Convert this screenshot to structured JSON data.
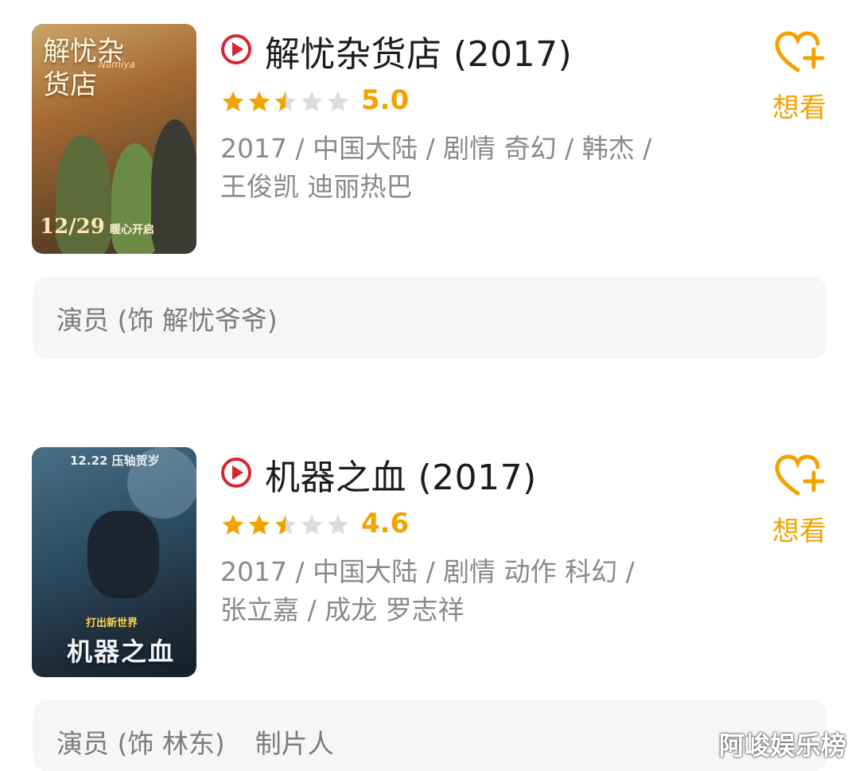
{
  "colors": {
    "accent": "#f2a300",
    "play_red": "#d8262e",
    "star_empty": "#dcdcdc",
    "meta_text": "#8a8a8a",
    "role_bg": "#f6f6f6"
  },
  "movies": [
    {
      "title": "解忧杂货店 (2017)",
      "rating_stars": 2.5,
      "score": "5.0",
      "meta_line1": "2017 / 中国大陆 / 剧情 奇幻 / 韩杰 /",
      "meta_line2": "王俊凯 迪丽热巴",
      "want_label": "想看",
      "role": "演员 (饰 解忧爷爷)",
      "role_extra": "",
      "poster": {
        "title": "解忧杂货店",
        "subtitle": "Namiya",
        "date": "12/29",
        "tag": "暖心开启"
      }
    },
    {
      "title": "机器之血 (2017)",
      "rating_stars": 2.5,
      "score": "4.6",
      "meta_line1": "2017 / 中国大陆 / 剧情 动作 科幻 /",
      "meta_line2": "张立嘉 / 成龙 罗志祥",
      "want_label": "想看",
      "role": "演员 (饰 林东)",
      "role_extra": "制片人",
      "poster": {
        "top": "12.22 压轴贺岁",
        "slogan": "打出新世界",
        "logo": "机器之血"
      }
    }
  ],
  "watermark": "阿峻娱乐榜"
}
